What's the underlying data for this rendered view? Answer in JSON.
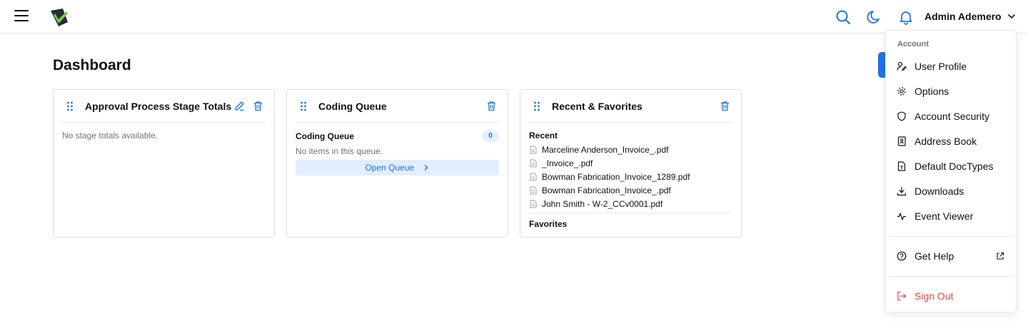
{
  "header": {
    "user_name": "Admin Ademero",
    "icons": [
      "menu-icon",
      "logo",
      "search-icon",
      "moon-icon",
      "bell-icon",
      "chevron-down-icon"
    ],
    "accent_color": "#1d74e5"
  },
  "page": {
    "title": "Dashboard"
  },
  "cards": {
    "approval": {
      "title": "Approval Process Stage Totals",
      "empty_text": "No stage totals available."
    },
    "coding": {
      "title": "Coding Queue",
      "queue_label": "Coding Queue",
      "count": "0",
      "empty_text": "No items in this queue.",
      "open_label": "Open Queue"
    },
    "recent": {
      "title": "Recent & Favorites",
      "recent_label": "Recent",
      "files": [
        "Marceline Anderson_Invoice_.pdf",
        "_Invoice_.pdf",
        "Bowman Fabrication_Invoice_1289.pdf",
        "Bowman Fabrication_Invoice_.pdf",
        "John Smith - W-2_CCv0001.pdf"
      ],
      "favorites_label": "Favorites"
    }
  },
  "menu": {
    "header": "Account",
    "items": [
      {
        "label": "User Profile",
        "icon": "user-pen-icon"
      },
      {
        "label": "Options",
        "icon": "gear-icon"
      },
      {
        "label": "Account Security",
        "icon": "shield-icon"
      },
      {
        "label": "Address Book",
        "icon": "contact-book-icon"
      },
      {
        "label": "Default DocTypes",
        "icon": "file-type-icon"
      },
      {
        "label": "Downloads",
        "icon": "download-icon"
      },
      {
        "label": "Event Viewer",
        "icon": "activity-icon"
      }
    ],
    "help": {
      "label": "Get Help",
      "icon": "help-circle-icon"
    },
    "sign_out": {
      "label": "Sign Out",
      "icon": "log-out-icon",
      "color": "#ef4444"
    }
  }
}
